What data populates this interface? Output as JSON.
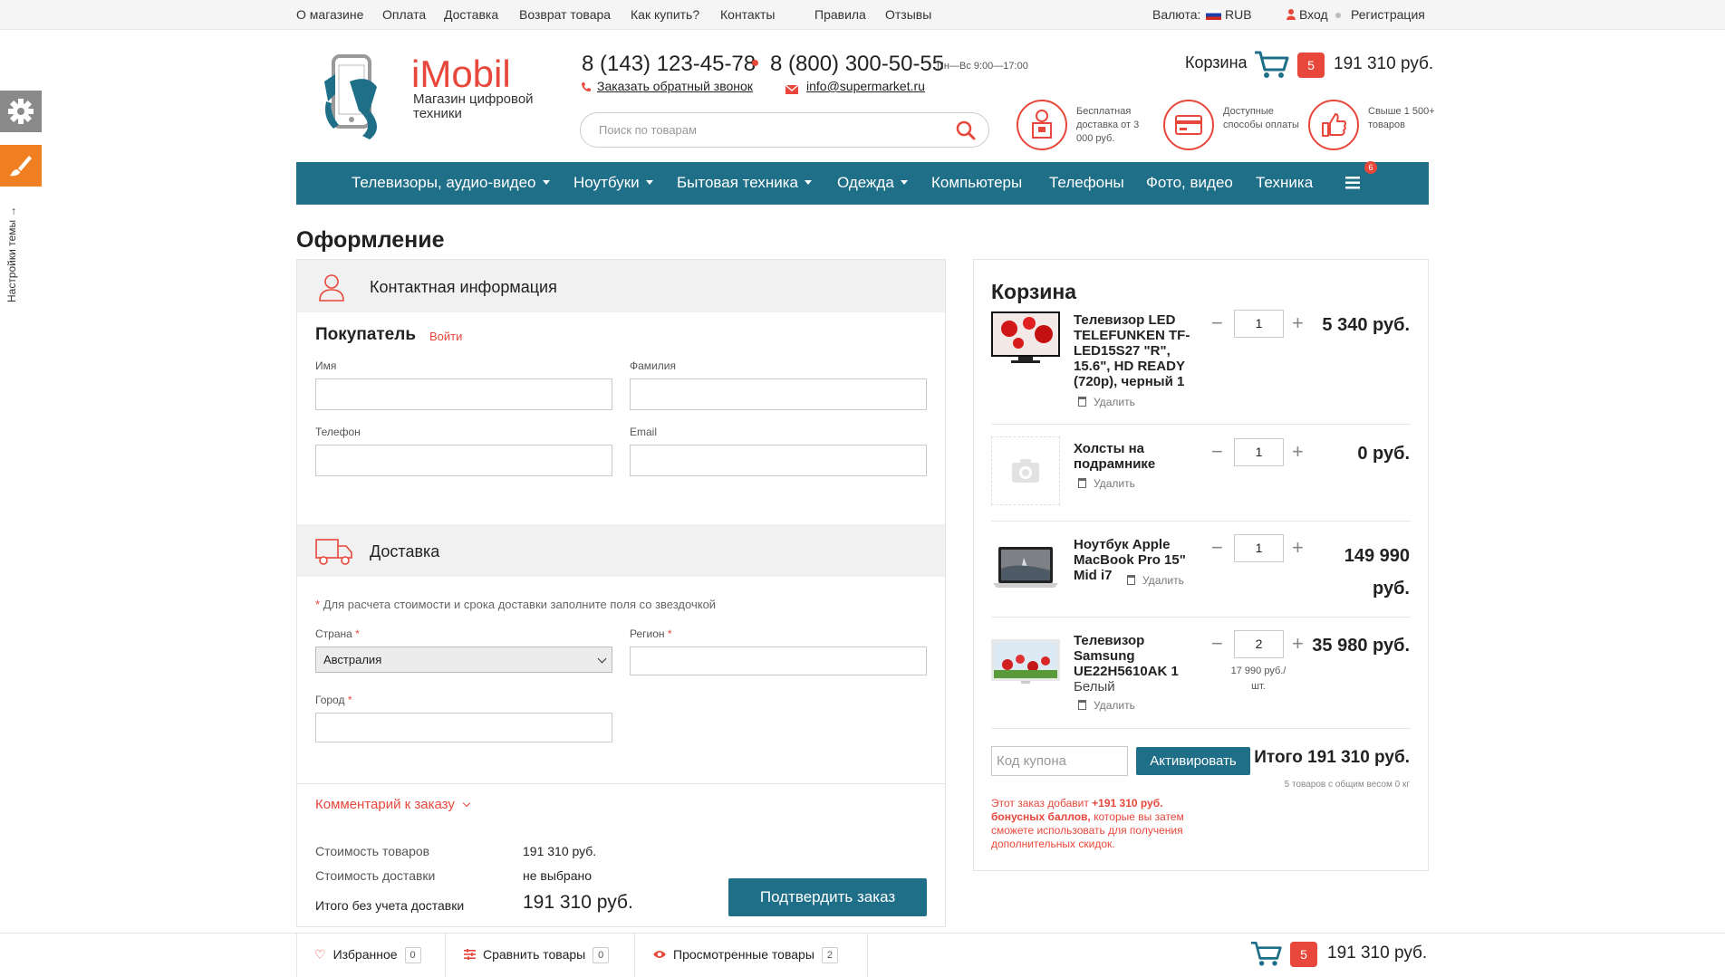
{
  "topnav": {
    "links": [
      "О магазине",
      "Оплата",
      "Доставка",
      "Возврат товара",
      "Как купить?",
      "Контакты",
      "Правила",
      "Отзывы"
    ],
    "currency_label": "Валюта:",
    "currency": "RUB",
    "login": "Вход",
    "register": "Регистрация"
  },
  "header": {
    "brand": "iMobil",
    "tagline": "Магазин цифровой техники",
    "phone1": "8 (143) 123-45-78",
    "phone2": "8 (800) 300-50-55",
    "hours": "Пн—Вс 9:00—17:00",
    "callback": "Заказать обратный звонок",
    "email": "info@supermarket.ru",
    "search_placeholder": "Поиск по товарам",
    "cart_label": "Корзина",
    "cart_count": "5",
    "cart_total": "191 310 руб.",
    "features": [
      {
        "text": "Бесплатная доставка от 3 000 руб.",
        "icon": "delivery-man-icon"
      },
      {
        "text": "Доступные способы оплаты",
        "icon": "credit-card-icon"
      },
      {
        "text": "Свыше 1 500+ товаров",
        "icon": "thumbs-up-icon"
      }
    ]
  },
  "nav": {
    "items": [
      "Телевизоры, аудио-видео",
      "Ноутбуки",
      "Бытовая техника",
      "Одежда",
      "Компьютеры",
      "Телефоны",
      "Фото, видео",
      "Техника"
    ],
    "more_badge": "6"
  },
  "sidebar": {
    "theme_label": "Настройки темы →"
  },
  "page": {
    "title": "Оформление"
  },
  "contact": {
    "section_title": "Контактная информация",
    "buyer_title": "Покупатель",
    "login_link": "Войти",
    "labels": {
      "first_name": "Имя",
      "last_name": "Фамилия",
      "phone": "Телефон",
      "email": "Email"
    }
  },
  "delivery": {
    "section_title": "Доставка",
    "note": "Для расчета стоимости и срока доставки заполните поля со звездочкой",
    "country_label": "Страна",
    "country_value": "Австралия",
    "region_label": "Регион",
    "city_label": "Город"
  },
  "comment_label": "Комментарий к заказу",
  "summary": {
    "goods_label": "Стоимость товаров",
    "goods_value": "191 310 руб.",
    "shipping_label": "Стоимость доставки",
    "shipping_value": "не выбрано",
    "total_label": "Итого без учета доставки",
    "total_value": "191 310 руб.",
    "confirm": "Подтвердить заказ"
  },
  "cart": {
    "title": "Корзина",
    "delete_label": "Удалить",
    "items": [
      {
        "name": "Телевизор LED TELEFUNKEN TF-LED15S27 \"R\", 15.6\", HD READY (720p), черный 1",
        "qty": "1",
        "price": "5 340 руб."
      },
      {
        "name": "Холсты на подрамнике",
        "qty": "1",
        "price": "0 руб."
      },
      {
        "name": "Ноутбук Apple MacBook Pro 15\" Mid i7",
        "qty": "1",
        "price": "149 990 руб."
      },
      {
        "name": "Телевизор Samsung UE22H5610AK 1",
        "variant": "Белый",
        "qty": "2",
        "unit_price": "17 990 руб./ шт.",
        "price": "35 980 руб."
      }
    ],
    "coupon_placeholder": "Код купона",
    "activate": "Активировать",
    "total": "Итого 191 310 руб.",
    "weight_note": "5 товаров с общим весом 0 кг",
    "bonus_prefix": "Этот заказ добавит",
    "bonus_amount": "+191 310 руб. бонусных баллов,",
    "bonus_suffix": "которые вы затем сможете использовать для получения дополнительных скидок."
  },
  "footer": {
    "favorites": "Избранное",
    "favorites_count": "0",
    "compare": "Сравнить товары",
    "compare_count": "0",
    "viewed": "Просмотренные товары",
    "viewed_count": "2",
    "cart_count": "5",
    "cart_total": "191 310 руб."
  },
  "colors": {
    "accent": "#e8473b",
    "primary": "#1f6f89",
    "orange": "#f07f22"
  }
}
